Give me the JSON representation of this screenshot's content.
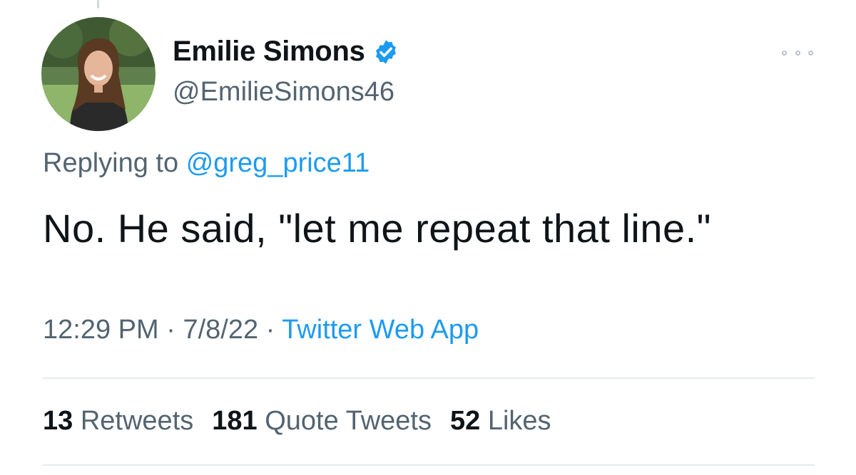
{
  "tweet": {
    "author": {
      "name": "Emilie Simons",
      "handle": "@EmilieSimons46",
      "verified": true
    },
    "replying_label": "Replying to",
    "replying_to": "@greg_price11",
    "text": "No. He said, \"let me repeat that line.\"",
    "time": "12:29 PM",
    "date": "7/8/22",
    "separator": "·",
    "source": "Twitter Web App"
  },
  "stats": {
    "retweets_count": "13",
    "retweets_label": "Retweets",
    "quotes_count": "181",
    "quotes_label": "Quote Tweets",
    "likes_count": "52",
    "likes_label": "Likes"
  },
  "colors": {
    "accent": "#1d9bf0",
    "secondary_text": "#536471",
    "primary_text": "#0f1419",
    "divider": "#e6eaed"
  },
  "icons": {
    "verified": "verified-badge-icon",
    "more": "more-options-icon"
  }
}
